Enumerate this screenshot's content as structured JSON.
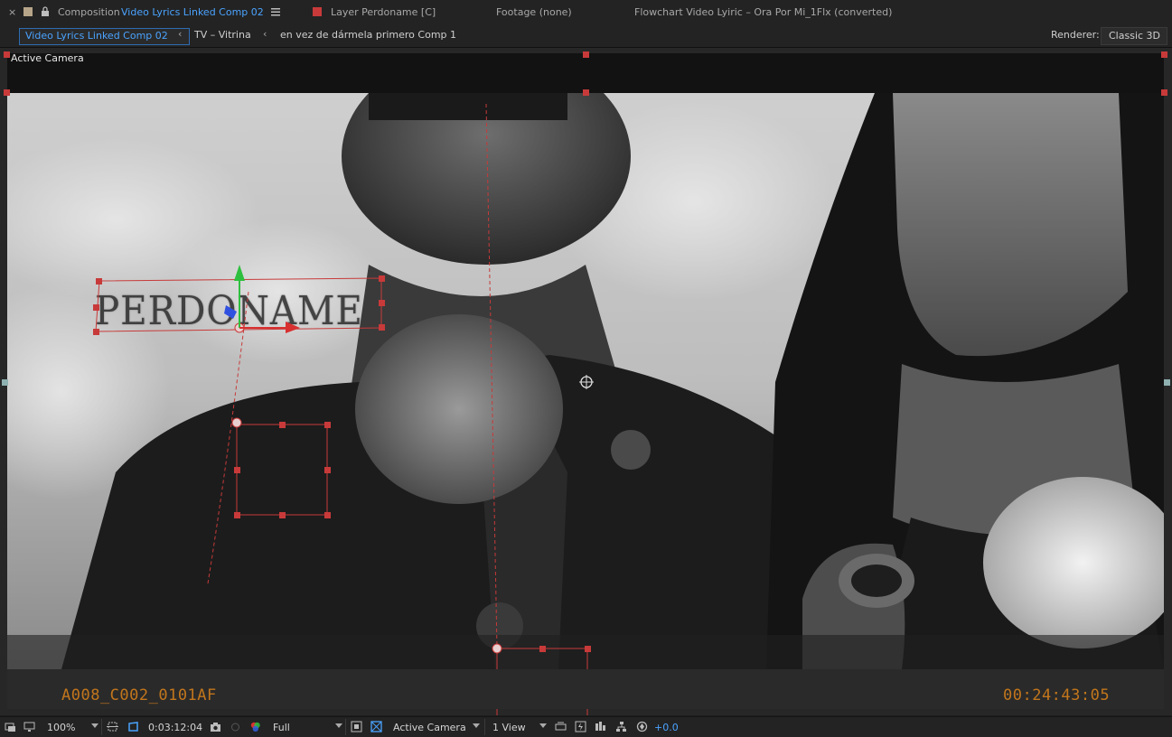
{
  "top_tabs": {
    "composition_prefix": "Composition",
    "composition_name": "Video Lyrics Linked Comp 02",
    "layer_tab": "Layer Perdoname [C]",
    "footage_tab": "Footage (none)",
    "flowchart_tab": "Flowchart Video Lyiric – Ora Por Mi_1Flx (converted)"
  },
  "breadcrumbs": {
    "active": "Video Lyrics Linked Comp 02",
    "item2": "TV – Vitrina",
    "item3": "en vez  de  dármela  primero Comp 1"
  },
  "renderer": {
    "label": "Renderer:",
    "value": "Classic 3D"
  },
  "viewer": {
    "label": "Active Camera",
    "overlay_title": "PERDONAME",
    "clip_name": "A008_C002_0101AF",
    "source_timecode": "00:24:43:05"
  },
  "bottom_bar": {
    "zoom": "100%",
    "current_time": "0:03:12:04",
    "resolution": "Full",
    "camera": "Active Camera",
    "views": "1 View",
    "exposure": "+0.0"
  },
  "colors": {
    "accent_blue": "#4aa3ff",
    "path_red": "#c83a3a",
    "timecode_orange": "#c2761c"
  }
}
